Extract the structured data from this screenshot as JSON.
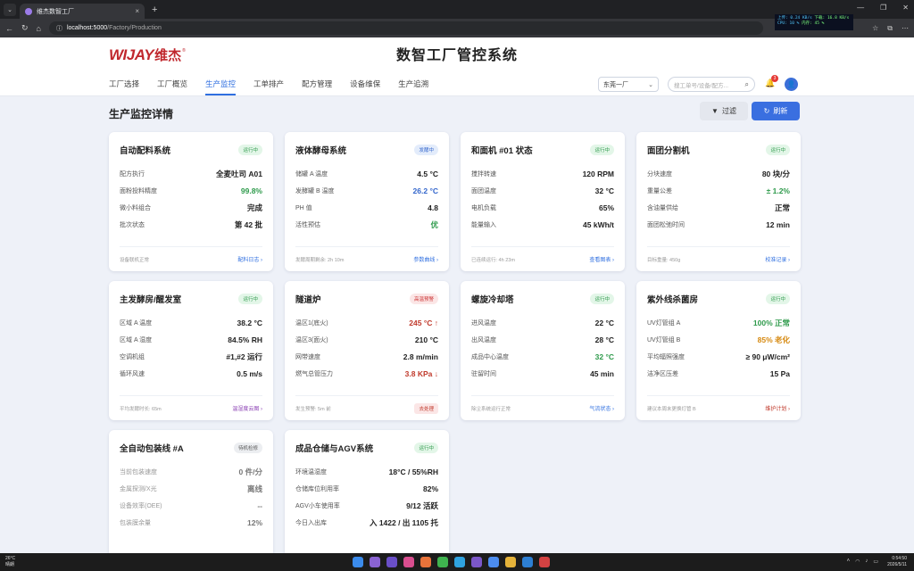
{
  "browser": {
    "tab_title": "维杰数智工厂",
    "tab_close": "×",
    "new_tab": "+",
    "url_host": "localhost:5000",
    "url_path": "/Factory/Production",
    "perf": {
      "up": "上传: 0.24 KB/s",
      "down": "下载: 16.8 KB/s",
      "cpu": "CPU: 10 %",
      "mem": "内存: 45 %"
    }
  },
  "header": {
    "logo_text": "WIJAY",
    "logo_cn": "维杰",
    "logo_reg": "®",
    "title": "数智工厂管控系统"
  },
  "nav": [
    "工厂选择",
    "工厂概览",
    "生产监控",
    "工单排产",
    "配方管理",
    "设备维保",
    "生产追溯"
  ],
  "nav_active": 2,
  "factory_select": "东莞一厂",
  "search_placeholder": "搜工单号/设备/配方...",
  "notification_count": "3",
  "section_title": "生产监控详情",
  "buttons": {
    "filter": "过滤",
    "refresh": "刷新"
  },
  "colors": {
    "accent": "#3a6fe0",
    "running": "#2e9a4b",
    "warning": "#c0392b"
  },
  "cards": [
    {
      "title": "自动配料系统",
      "status": "运行中",
      "status_type": "green",
      "rows": [
        {
          "k": "配方执行",
          "v": "全麦吐司 A01",
          "c": ""
        },
        {
          "k": "面粉投料精度",
          "v": "99.8%",
          "c": "green"
        },
        {
          "k": "微小料组合",
          "v": "完成",
          "c": ""
        },
        {
          "k": "批次状态",
          "v": "第 42 批",
          "c": ""
        }
      ],
      "foot_note": "设备联机正常",
      "foot_link": "配料日志",
      "foot_style": "link"
    },
    {
      "title": "液体酵母系统",
      "status": "发酵中",
      "status_type": "blue",
      "rows": [
        {
          "k": "储罐 A 温度",
          "v": "4.5 °C",
          "c": ""
        },
        {
          "k": "发酵罐 B 温度",
          "v": "26.2 °C",
          "c": "blue"
        },
        {
          "k": "PH 值",
          "v": "4.8",
          "c": ""
        },
        {
          "k": "活性预估",
          "v": "优",
          "c": "green"
        }
      ],
      "foot_note": "发酵周期剩余: 2h 10m",
      "foot_link": "参数曲线",
      "foot_style": "link"
    },
    {
      "title": "和面机 #01 状态",
      "status": "运行中",
      "status_type": "green",
      "rows": [
        {
          "k": "搅拌转速",
          "v": "120 RPM",
          "c": ""
        },
        {
          "k": "面团温度",
          "v": "32 °C",
          "c": ""
        },
        {
          "k": "电机负载",
          "v": "65%",
          "c": ""
        },
        {
          "k": "能量输入",
          "v": "45 kWh/t",
          "c": ""
        }
      ],
      "foot_note": "已连续运行: 4h 23m",
      "foot_link": "查看图表",
      "foot_style": "link"
    },
    {
      "title": "面团分割机",
      "status": "运行中",
      "status_type": "green",
      "rows": [
        {
          "k": "分块速度",
          "v": "80 块/分",
          "c": ""
        },
        {
          "k": "重量公差",
          "v": "± 1.2%",
          "c": "green"
        },
        {
          "k": "含油量供给",
          "v": "正常",
          "c": ""
        },
        {
          "k": "面团松弛时间",
          "v": "12 min",
          "c": ""
        }
      ],
      "foot_note": "目标重量: 450g",
      "foot_link": "校准记录",
      "foot_style": "link"
    },
    {
      "title": "主发酵房/醒发室",
      "status": "运行中",
      "status_type": "green",
      "rows": [
        {
          "k": "区域 A 温度",
          "v": "38.2 °C",
          "c": ""
        },
        {
          "k": "区域 A 湿度",
          "v": "84.5% RH",
          "c": ""
        },
        {
          "k": "空调机组",
          "v": "#1,#2 运行",
          "c": ""
        },
        {
          "k": "循环风速",
          "v": "0.5 m/s",
          "c": ""
        }
      ],
      "foot_note": "平均发酵时长: 65m",
      "foot_link": "温湿度云图",
      "foot_style": "purple"
    },
    {
      "title": "隧道炉",
      "status": "高温预警",
      "status_type": "red",
      "rows": [
        {
          "k": "温区1(底火)",
          "v": "245 °C ↑",
          "c": "red"
        },
        {
          "k": "温区3(面火)",
          "v": "210 °C",
          "c": ""
        },
        {
          "k": "网带速度",
          "v": "2.8 m/min",
          "c": ""
        },
        {
          "k": "燃气总管压力",
          "v": "3.8 KPa ↓",
          "c": "red"
        }
      ],
      "foot_note": "发生预警: 5m 前",
      "foot_link": "去处理",
      "foot_style": "tag"
    },
    {
      "title": "螺旋冷却塔",
      "status": "运行中",
      "status_type": "green",
      "rows": [
        {
          "k": "进风温度",
          "v": "22 °C",
          "c": ""
        },
        {
          "k": "出风温度",
          "v": "28 °C",
          "c": ""
        },
        {
          "k": "成品中心温度",
          "v": "32 °C",
          "c": "green"
        },
        {
          "k": "驻留时间",
          "v": "45 min",
          "c": ""
        }
      ],
      "foot_note": "除尘系统运行正常",
      "foot_link": "气流状态",
      "foot_style": "link"
    },
    {
      "title": "紫外线杀菌房",
      "status": "运行中",
      "status_type": "green",
      "rows": [
        {
          "k": "UV灯管组 A",
          "v": "100% 正常",
          "c": "green"
        },
        {
          "k": "UV灯管组 B",
          "v": "85% 老化",
          "c": "orange"
        },
        {
          "k": "平均辐照强度",
          "v": "≥ 90 μW/cm²",
          "c": ""
        },
        {
          "k": "洁净区压差",
          "v": "15 Pa",
          "c": ""
        }
      ],
      "foot_note": "建议本周末更换灯管 B",
      "foot_link": "维护计划",
      "foot_style": "red"
    },
    {
      "title": "全自动包装线 #A",
      "status": "待机检修",
      "status_type": "gray",
      "rows": [
        {
          "k": "当前包装速度",
          "v": "0 件/分",
          "c": "dim",
          "kc": "dim"
        },
        {
          "k": "金属探测/X光",
          "v": "离线",
          "c": "dim",
          "kc": "dim"
        },
        {
          "k": "设备效率(OEE)",
          "v": "--",
          "c": "dim",
          "kc": "dim"
        },
        {
          "k": "包装膜余量",
          "v": "12%",
          "c": "dim",
          "kc": "dim"
        }
      ],
      "foot_note": "",
      "foot_link": "",
      "foot_style": "none"
    },
    {
      "title": "成品仓储与AGV系统",
      "status": "运行中",
      "status_type": "green",
      "rows": [
        {
          "k": "环境温湿度",
          "v": "18°C / 55%RH",
          "c": ""
        },
        {
          "k": "仓储库位利用率",
          "v": "82%",
          "c": ""
        },
        {
          "k": "AGV小车使用率",
          "v": "9/12 活跃",
          "c": ""
        },
        {
          "k": "今日入出库",
          "v": "入 1422 / 出 1105 托",
          "c": ""
        }
      ],
      "foot_note": "",
      "foot_link": "",
      "foot_style": "none"
    }
  ],
  "taskbar": {
    "weather_temp": "26°C",
    "weather_desc": "晴朗",
    "time": "0:54:50",
    "date": "2026/5/11"
  }
}
